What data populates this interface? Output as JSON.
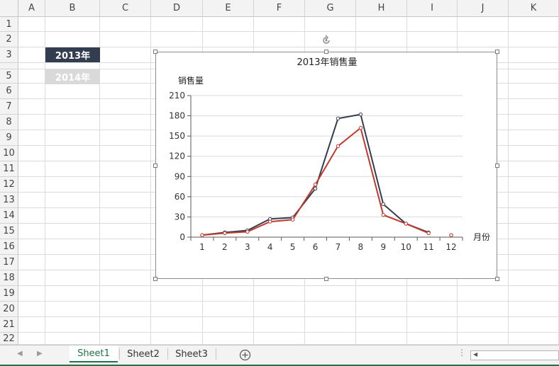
{
  "columns": [
    "A",
    "B",
    "C",
    "D",
    "E",
    "F",
    "G",
    "H",
    "I",
    "J",
    "K"
  ],
  "rows": [
    "1",
    "2",
    "3",
    "4",
    "5",
    "6",
    "7",
    "8",
    "9",
    "10",
    "11",
    "12",
    "13",
    "14",
    "15",
    "16",
    "17",
    "18",
    "19",
    "20",
    "21",
    "22"
  ],
  "controls": {
    "button_2013": "2013年",
    "button_2014": "2014年",
    "color_selected": "#323e4f",
    "color_unselected": "#d9d9d9"
  },
  "sheet_tabs": [
    "Sheet1",
    "Sheet2",
    "Sheet3"
  ],
  "active_tab": "Sheet1",
  "icons": {
    "add_sheet": "plus-circle-icon",
    "rotate": "rotate-handle-icon",
    "scroll_left": "scroll-left-icon",
    "scroll_right": "scroll-right-icon"
  },
  "chart_data": {
    "type": "line",
    "title": "2013年销售量",
    "ylabel": "销售量",
    "xlabel": "月份",
    "categories": [
      "1",
      "2",
      "3",
      "4",
      "5",
      "6",
      "7",
      "8",
      "9",
      "10",
      "11",
      "12"
    ],
    "ylim": [
      0,
      210
    ],
    "yticks": [
      0,
      30,
      60,
      90,
      120,
      150,
      180,
      210
    ],
    "grid": true,
    "legend": "none",
    "series": [
      {
        "color": "#323e4f",
        "values": [
          3,
          7,
          10,
          27,
          29,
          72,
          176,
          182,
          49,
          20,
          7,
          3
        ]
      },
      {
        "color": "#c0392b",
        "values": [
          3,
          6,
          8,
          23,
          26,
          78,
          135,
          162,
          33,
          20,
          6,
          3
        ]
      }
    ]
  }
}
